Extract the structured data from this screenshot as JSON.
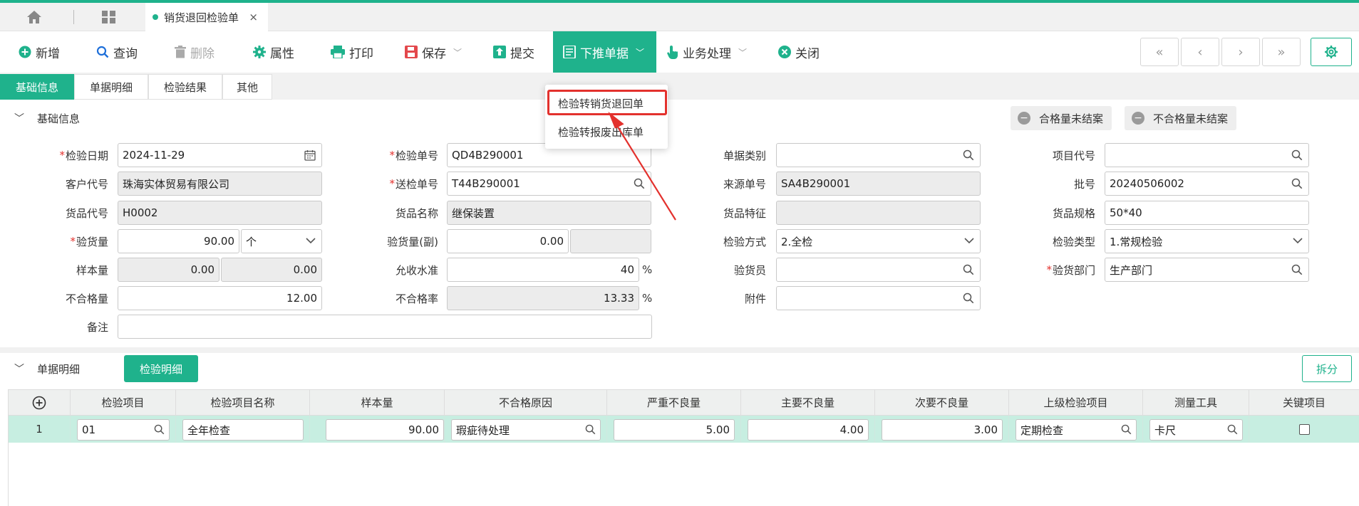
{
  "tabs": {
    "doc_tab": "销货退回检验单",
    "close": "×"
  },
  "toolbar": {
    "new": "新增",
    "query": "查询",
    "delete": "删除",
    "props": "属性",
    "print": "打印",
    "save": "保存",
    "submit": "提交",
    "push": "下推单据",
    "business": "业务处理",
    "close": "关闭",
    "nav_first": "«",
    "nav_prev": "‹",
    "nav_next": "›",
    "nav_last": "»"
  },
  "subtabs": [
    "基础信息",
    "单据明细",
    "检验结果",
    "其他"
  ],
  "section_basic": "基础信息",
  "badges": {
    "qualified": "合格量未结案",
    "unqualified": "不合格量未结案"
  },
  "dropdown": {
    "item1": "检验转销货退回单",
    "item2": "检验转报废出库单"
  },
  "form": {
    "inspect_date": {
      "label": "检验日期",
      "value": "2024-11-29"
    },
    "customer_code": {
      "label": "客户代号",
      "value": "珠海实体贸易有限公司"
    },
    "item_code": {
      "label": "货品代号",
      "value": "H0002"
    },
    "inspect_qty": {
      "label": "验货量",
      "value": "90.00",
      "unit": "个"
    },
    "sample_qty": {
      "label": "样本量",
      "value1": "0.00",
      "value2": "0.00"
    },
    "unqualified_qty": {
      "label": "不合格量",
      "value": "12.00"
    },
    "remark": {
      "label": "备注",
      "value": ""
    },
    "inspect_no": {
      "label": "检验单号",
      "value": "QD4B290001"
    },
    "send_no": {
      "label": "送检单号",
      "value": "T44B290001"
    },
    "item_name": {
      "label": "货品名称",
      "value": "继保装置"
    },
    "inspect_qty_sub": {
      "label": "验货量(副)",
      "value": "0.00",
      "value2": ""
    },
    "aql": {
      "label": "允收水准",
      "value": "40",
      "unit": "%"
    },
    "unqualified_rate": {
      "label": "不合格率",
      "value": "13.33",
      "unit": "%"
    },
    "doc_type": {
      "label": "单据类别",
      "value": ""
    },
    "source_no": {
      "label": "来源单号",
      "value": "SA4B290001"
    },
    "item_feature": {
      "label": "货品特征",
      "value": ""
    },
    "inspect_method": {
      "label": "检验方式",
      "value": "2.全检"
    },
    "inspector": {
      "label": "验货员",
      "value": ""
    },
    "attachment": {
      "label": "附件",
      "value": ""
    },
    "project_code": {
      "label": "项目代号",
      "value": ""
    },
    "batch_no": {
      "label": "批号",
      "value": "20240506002"
    },
    "item_spec": {
      "label": "货品规格",
      "value": "50*40"
    },
    "inspect_type": {
      "label": "检验类型",
      "value": "1.常规检验"
    },
    "dept": {
      "label": "验货部门",
      "value": "生产部门"
    }
  },
  "detail": {
    "section_title": "单据明细",
    "tab": "检验明细",
    "split": "拆分",
    "columns": [
      "检验项目",
      "检验项目名称",
      "样本量",
      "不合格原因",
      "严重不良量",
      "主要不良量",
      "次要不良量",
      "上级检验项目",
      "测量工具",
      "关键项目"
    ],
    "row": {
      "index": "1",
      "item": "01",
      "item_name": "全年检查",
      "sample": "90.00",
      "reason": "瑕疵待处理",
      "severe": "5.00",
      "major": "4.00",
      "minor": "3.00",
      "parent": "定期检查",
      "tool": "卡尺",
      "key": false
    }
  },
  "colors": {
    "accent": "#1fb28c",
    "required": "#e3312d",
    "row_bg": "#c7eee1"
  }
}
